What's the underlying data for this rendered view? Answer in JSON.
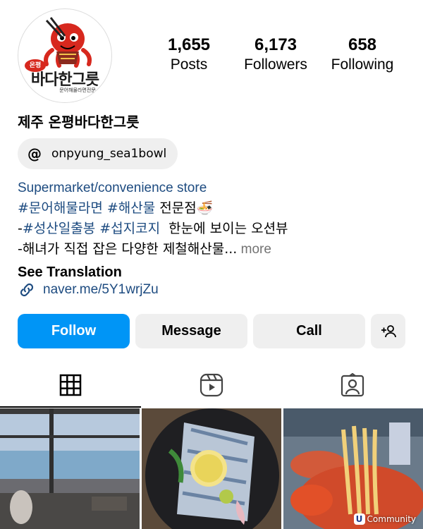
{
  "profile": {
    "avatar_text": "바다한그릇",
    "avatar_badge": "온평",
    "avatar_sub": "문어해물라면전문",
    "name": "제주 온평바다한그릇"
  },
  "stats": [
    {
      "value": "1,655",
      "label": "Posts"
    },
    {
      "value": "6,173",
      "label": "Followers"
    },
    {
      "value": "658",
      "label": "Following"
    }
  ],
  "threads": {
    "handle": "onpyung_sea1bowl",
    "icon": "threads-icon"
  },
  "bio": {
    "category": "Supermarket/convenience store",
    "line2_tags": "#문어해물라면 #해산물",
    "line2_rest": " 전문점",
    "line2_emoji": "🍜",
    "line3_prefix": "-",
    "line3_tags": "#성산일출봉 #섭지코지",
    "line3_rest": "  한눈에 보이는 오션뷰",
    "line4": "-해녀가 직접 잡은 다양한 제철해산물...",
    "line4_more": " more",
    "see_translation": "See Translation"
  },
  "link": {
    "text": "naver.me/5Y1wrjZu",
    "icon": "link-icon"
  },
  "actions": {
    "follow": "Follow",
    "message": "Message",
    "call": "Call",
    "add_person_icon": "add-person-icon"
  },
  "tabs": [
    {
      "name": "grid",
      "icon": "grid-icon",
      "active": true
    },
    {
      "name": "reels",
      "icon": "reels-icon",
      "active": false
    },
    {
      "name": "tagged",
      "icon": "tagged-icon",
      "active": false
    }
  ],
  "watermark": {
    "letter": "U",
    "text": "Community"
  },
  "colors": {
    "follow_blue": "#0095f6",
    "link_blue": "#1d4b80",
    "button_gray": "#efefef"
  }
}
